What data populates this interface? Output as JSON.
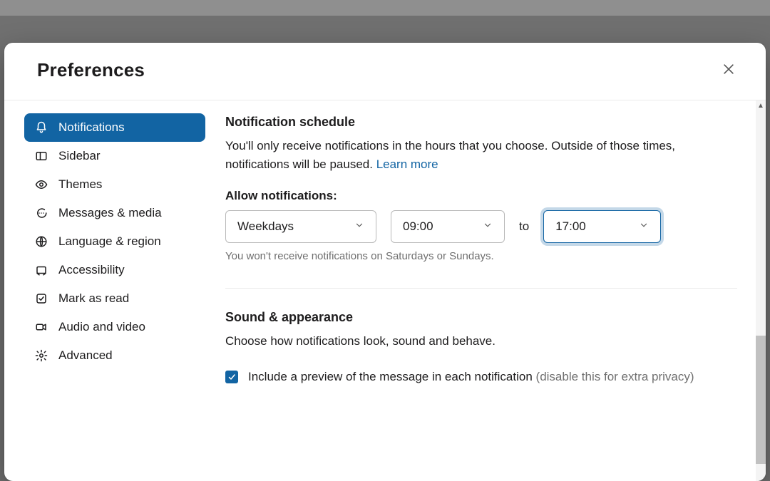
{
  "modal": {
    "title": "Preferences"
  },
  "sidebar": {
    "items": [
      {
        "label": "Notifications"
      },
      {
        "label": "Sidebar"
      },
      {
        "label": "Themes"
      },
      {
        "label": "Messages & media"
      },
      {
        "label": "Language & region"
      },
      {
        "label": "Accessibility"
      },
      {
        "label": "Mark as read"
      },
      {
        "label": "Audio and video"
      },
      {
        "label": "Advanced"
      }
    ]
  },
  "schedule": {
    "title": "Notification schedule",
    "description": "You'll only receive notifications in the hours that you choose. Outside of those times, notifications will be paused. ",
    "learn_more": "Learn more",
    "allow_label": "Allow notifications:",
    "days_value": "Weekdays",
    "start_value": "09:00",
    "to": "to",
    "end_value": "17:00",
    "weekday_note": "You won't receive notifications on Saturdays or Sundays."
  },
  "sound": {
    "title": "Sound & appearance",
    "description": "Choose how notifications look, sound and behave.",
    "check1_text": "Include a preview of the message in each notification ",
    "check1_hint": "(disable this for extra privacy)"
  }
}
